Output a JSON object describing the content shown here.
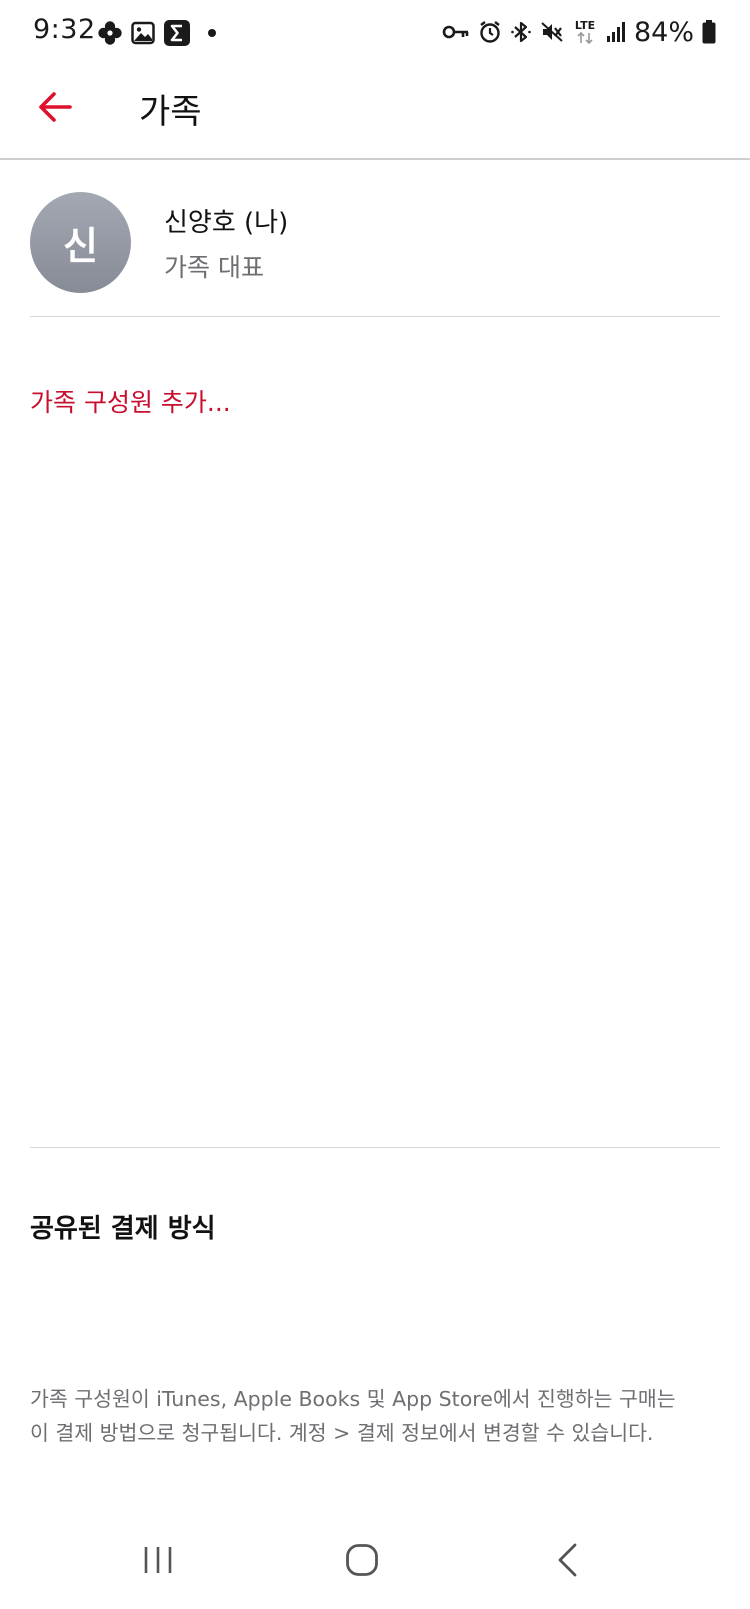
{
  "status_bar": {
    "time": "9:32",
    "battery": "84%",
    "left_icons": [
      "pinwheel-icon",
      "gallery-icon",
      "sigma-icon",
      "dot-icon"
    ],
    "right_icons": [
      "key-icon",
      "alarm-icon",
      "bluetooth-icon",
      "mute-icon",
      "lte-icon",
      "signal-icon",
      "battery-icon"
    ]
  },
  "app_bar": {
    "title": "가족",
    "back_icon": "arrow-left-icon",
    "accent_color": "#e0102d"
  },
  "member": {
    "initial": "신",
    "name": "신양호 (나)",
    "role": "가족 대표"
  },
  "add_member_label": "가족 구성원 추가...",
  "payment": {
    "title": "공유된 결제 방식",
    "description": "가족 구성원이 iTunes, Apple Books 및 App Store에서 진행하는 구매는 이 결제 방법으로 청구됩니다. 계정 > 결제 정보에서 변경할 수 있습니다."
  },
  "nav_bar": {
    "icons": [
      "recent-apps-icon",
      "home-icon",
      "back-icon"
    ]
  }
}
